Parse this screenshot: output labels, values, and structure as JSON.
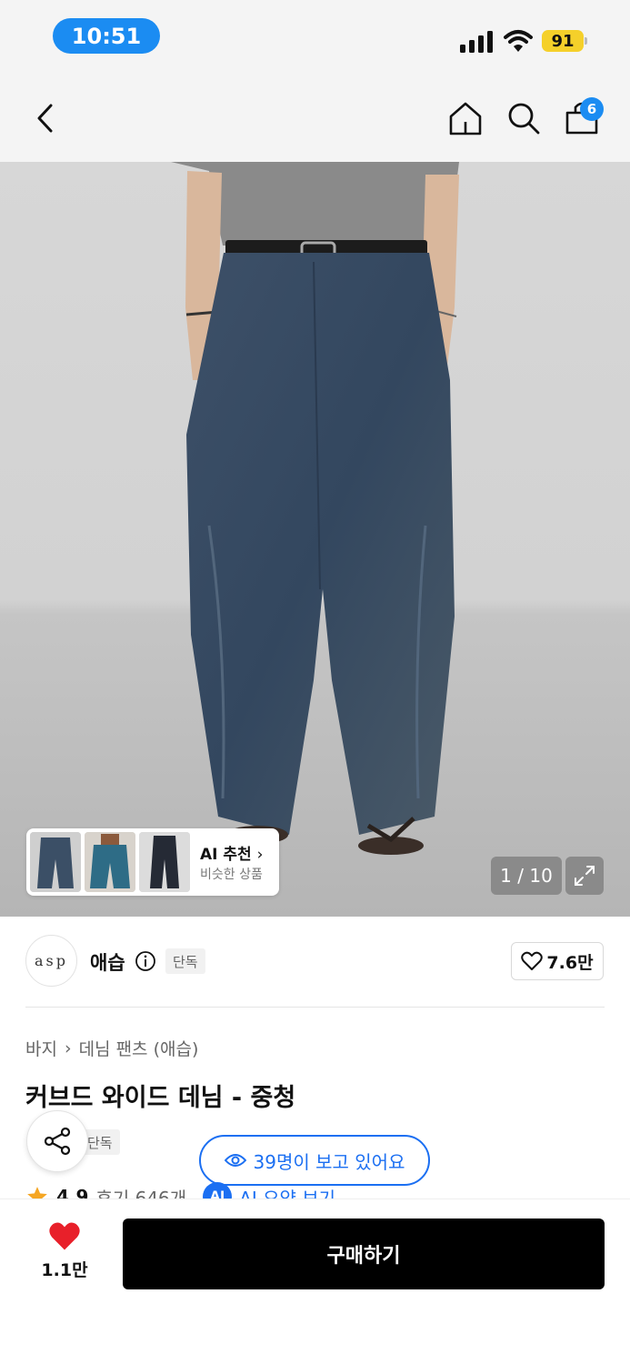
{
  "status_bar": {
    "time": "10:51",
    "battery": "91"
  },
  "nav": {
    "cart_count": "6"
  },
  "gallery": {
    "ai_title": "AI 추천",
    "ai_subtitle": "비슷한 상품",
    "counter": "1 / 10"
  },
  "brand": {
    "logo_text": "asp",
    "name": "애습",
    "tag": "단독",
    "like_count": "7.6만"
  },
  "breadcrumb": {
    "category": "바지",
    "subcategory": "데님 팬츠 (애습)"
  },
  "product": {
    "title": "커브드 와이드 데님 - 중청",
    "tag_partial": "단독",
    "viewers_text": "39명이 보고 있어요",
    "rating": "4.9",
    "review_text": "후기 646개",
    "ai_badge": "AI",
    "ai_summary": "AI 요약 보기"
  },
  "bottom_bar": {
    "wish_count": "1.1만",
    "buy_label": "구매하기"
  },
  "colors": {
    "accent_blue": "#1b6ff2",
    "status_blue": "#1b8cf2",
    "heart_red": "#e8202a",
    "star_orange": "#f5a623"
  }
}
